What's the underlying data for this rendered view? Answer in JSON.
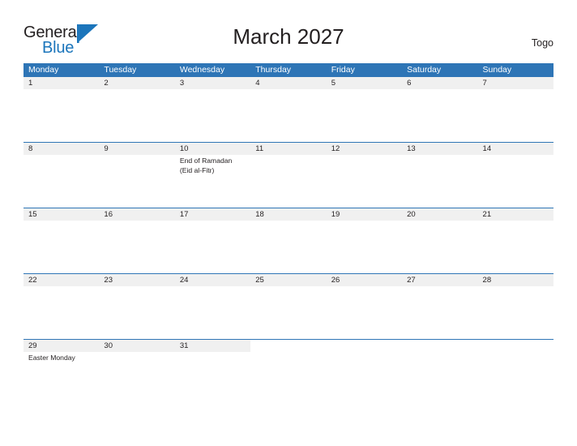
{
  "brand": {
    "name_part1": "General",
    "name_part2": "Blue",
    "flag_icon": "blue-flag-triangle",
    "color_dark": "#231f20",
    "color_blue": "#1b75bb"
  },
  "header": {
    "title": "March 2027",
    "country": "Togo"
  },
  "theme": {
    "header_blue": "#2e75b6",
    "date_band_gray": "#f0f0f0",
    "text_dark": "#231f20",
    "background": "#ffffff"
  },
  "calendar": {
    "month": "March",
    "year": "2027",
    "weekdays": [
      "Monday",
      "Tuesday",
      "Wednesday",
      "Thursday",
      "Friday",
      "Saturday",
      "Sunday"
    ],
    "weeks": [
      {
        "days": [
          {
            "num": "1",
            "events": []
          },
          {
            "num": "2",
            "events": []
          },
          {
            "num": "3",
            "events": []
          },
          {
            "num": "4",
            "events": []
          },
          {
            "num": "5",
            "events": []
          },
          {
            "num": "6",
            "events": []
          },
          {
            "num": "7",
            "events": []
          }
        ]
      },
      {
        "days": [
          {
            "num": "8",
            "events": []
          },
          {
            "num": "9",
            "events": []
          },
          {
            "num": "10",
            "events": [
              "End of Ramadan",
              "(Eid al-Fitr)"
            ]
          },
          {
            "num": "11",
            "events": []
          },
          {
            "num": "12",
            "events": []
          },
          {
            "num": "13",
            "events": []
          },
          {
            "num": "14",
            "events": []
          }
        ]
      },
      {
        "days": [
          {
            "num": "15",
            "events": []
          },
          {
            "num": "16",
            "events": []
          },
          {
            "num": "17",
            "events": []
          },
          {
            "num": "18",
            "events": []
          },
          {
            "num": "19",
            "events": []
          },
          {
            "num": "20",
            "events": []
          },
          {
            "num": "21",
            "events": []
          }
        ]
      },
      {
        "days": [
          {
            "num": "22",
            "events": []
          },
          {
            "num": "23",
            "events": []
          },
          {
            "num": "24",
            "events": []
          },
          {
            "num": "25",
            "events": []
          },
          {
            "num": "26",
            "events": []
          },
          {
            "num": "27",
            "events": []
          },
          {
            "num": "28",
            "events": []
          }
        ]
      },
      {
        "days": [
          {
            "num": "29",
            "events": [
              "Easter Monday"
            ]
          },
          {
            "num": "30",
            "events": []
          },
          {
            "num": "31",
            "events": []
          },
          {
            "num": "",
            "events": []
          },
          {
            "num": "",
            "events": []
          },
          {
            "num": "",
            "events": []
          },
          {
            "num": "",
            "events": []
          }
        ]
      }
    ]
  }
}
